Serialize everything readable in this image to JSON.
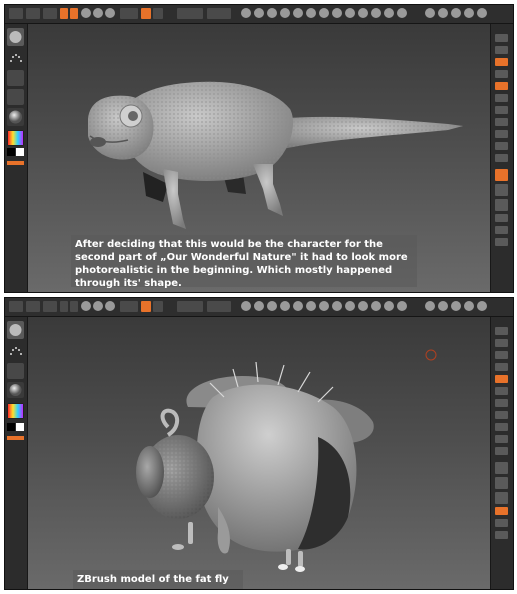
{
  "panels": [
    {
      "caption": "After deciding that this would be the character for the second part of „Our Wonderful Nature\" it had to look more photorealistic in the beginning. Which mostly happened through its' shape.",
      "model": "chameleon"
    },
    {
      "caption": "ZBrush model of the fat fly",
      "model": "fly"
    }
  ],
  "ui": {
    "accent_color": "#e8722a",
    "panel_bg": "#2e2e2e",
    "viewport_top": "#3a3a3a",
    "viewport_bottom": "#6a6a6a"
  }
}
